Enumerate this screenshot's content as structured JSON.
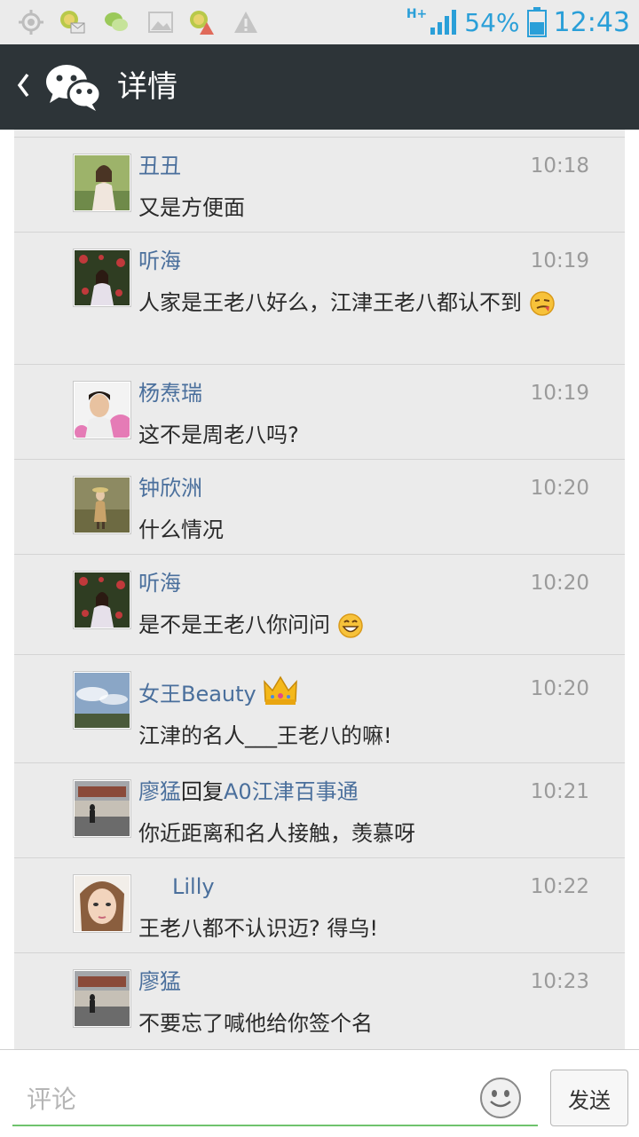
{
  "status_bar": {
    "network": "H+",
    "battery": "54%",
    "time": "12:43"
  },
  "header": {
    "back_icon": "chevron-left-icon",
    "logo_icon": "wechat-logo-icon",
    "title": "详情"
  },
  "comments": [
    {
      "name": "丑丑",
      "time": "10:18",
      "text": "又是方便面"
    },
    {
      "name": "听海",
      "time": "10:19",
      "text": "人家是王老八好么，江津王老八都认不到",
      "emoji": "smirk-emoji"
    },
    {
      "name": "杨焘瑞",
      "time": "10:19",
      "text": "这不是周老八吗?"
    },
    {
      "name": "钟欣洲",
      "time": "10:20",
      "text": "什么情况"
    },
    {
      "name": "听海",
      "time": "10:20",
      "text": "是不是王老八你问问",
      "emoji": "grin-emoji"
    },
    {
      "name": "女王Beauty",
      "name_emoji": "crown-emoji",
      "time": "10:20",
      "text": "江津的名人___王老八的嘛!"
    },
    {
      "name": "廖猛",
      "reply_word": "回复",
      "reply_to": "A0江津百事通",
      "time": "10:21",
      "text": "你近距离和名人接触，羡慕呀"
    },
    {
      "name": "Lilly",
      "time": "10:22",
      "text": "王老八都不认识迈? 得乌!"
    },
    {
      "name": "廖猛",
      "time": "10:23",
      "text": "不要忘了喊他给你签个名"
    }
  ],
  "footer": {
    "placeholder": "评论",
    "emoji_icon": "smiley-face-icon",
    "send_label": "发送"
  },
  "colors": {
    "titlebar": "#2d3438",
    "name": "#4a6f9c",
    "status_accent": "#2a9fd8",
    "input_underline": "#6fc36d"
  }
}
